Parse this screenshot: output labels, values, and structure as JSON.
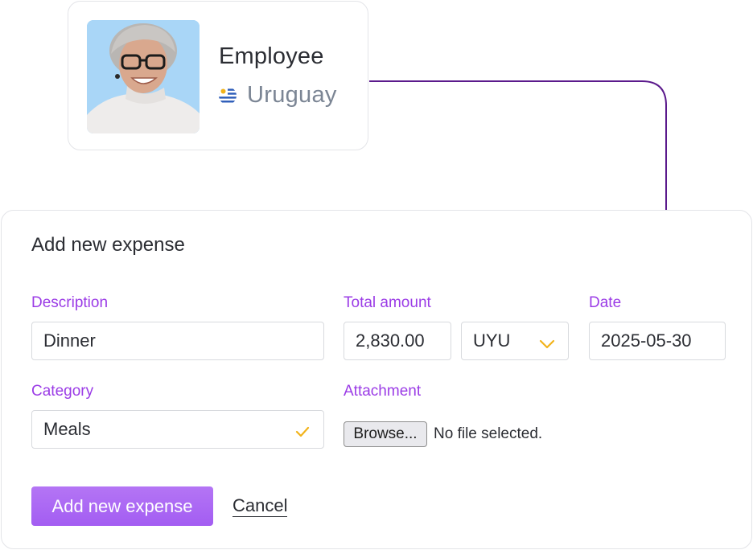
{
  "employee": {
    "role": "Employee",
    "country": "Uruguay",
    "flag_icon": "uruguay-flag-icon"
  },
  "form": {
    "title": "Add new expense",
    "description": {
      "label": "Description",
      "value": "Dinner"
    },
    "total_amount": {
      "label": "Total amount",
      "value": "2,830.00",
      "currency": "UYU"
    },
    "date": {
      "label": "Date",
      "value": "2025-05-30"
    },
    "category": {
      "label": "Category",
      "value": "Meals"
    },
    "attachment": {
      "label": "Attachment",
      "browse_label": "Browse...",
      "status": "No file selected."
    },
    "submit_label": "Add new expense",
    "cancel_label": "Cancel"
  },
  "colors": {
    "accent": "#9b3ce6",
    "connector": "#5b1a8c",
    "chevron": "#f2b31a",
    "button": "#a35df2"
  }
}
